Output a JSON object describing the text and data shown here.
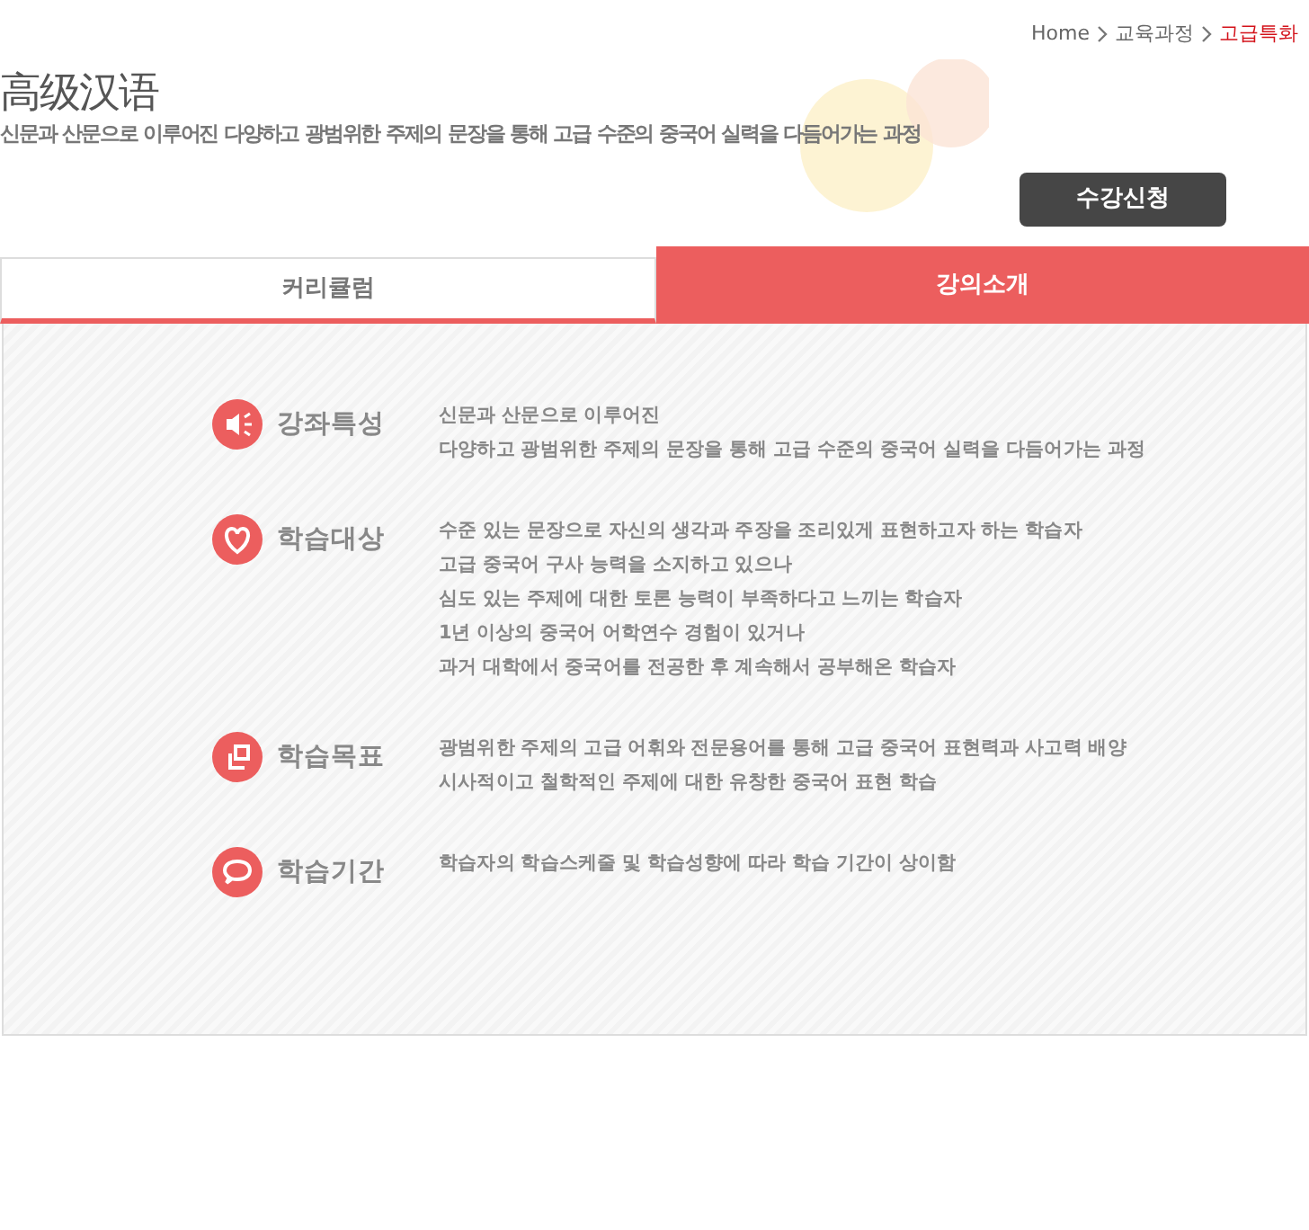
{
  "breadcrumb": [
    {
      "label": "Home",
      "selected": false
    },
    {
      "label": "교육과정",
      "selected": false
    },
    {
      "label": "고급특화",
      "selected": true
    }
  ],
  "page_title": "高级汉语",
  "subtitle": "신문과 산문으로 이루어진 다양하고 광범위한 주제의 문장을 통해 고급 수준의 중국어 실력을 다듬어가는 과정",
  "apply_button": "수강신청",
  "tabs": [
    {
      "label": "커리큘럼",
      "selected": false
    },
    {
      "label": "강의소개",
      "selected": true
    }
  ],
  "sections": [
    {
      "kind": "speaker",
      "title": "강좌특성",
      "lines": [
        "신문과 산문으로 이루어진",
        "다양하고 광범위한 주제의 문장을 통해 고급 수준의 중국어 실력을 다듬어가는 과정"
      ]
    },
    {
      "kind": "heart",
      "title": "학습대상",
      "lines": [
        "수준 있는 문장으로 자신의 생각과 주장을 조리있게 표현하고자 하는 학습자",
        "고급 중국어 구사 능력을 소지하고 있으나",
        "심도 있는 주제에 대한 토론 능력이 부족하다고 느끼는 학습자",
        "1년 이상의 중국어 어학연수 경험이 있거나",
        "과거 대학에서 중국어를 전공한 후 계속해서 공부해온 학습자"
      ]
    },
    {
      "kind": "window",
      "title": "학습목표",
      "lines": [
        "광범위한 주제의 고급 어휘와 전문용어를 통해 고급 중국어 표현력과 사고력 배양",
        "시사적이고 철학적인 주제에 대한 유창한 중국어 표현 학습"
      ]
    },
    {
      "kind": "chat",
      "title": "학습기간",
      "lines": [
        "학습자의 학습스케줄 및 학습성향에 따라 학습 기간이 상이함"
      ]
    }
  ]
}
